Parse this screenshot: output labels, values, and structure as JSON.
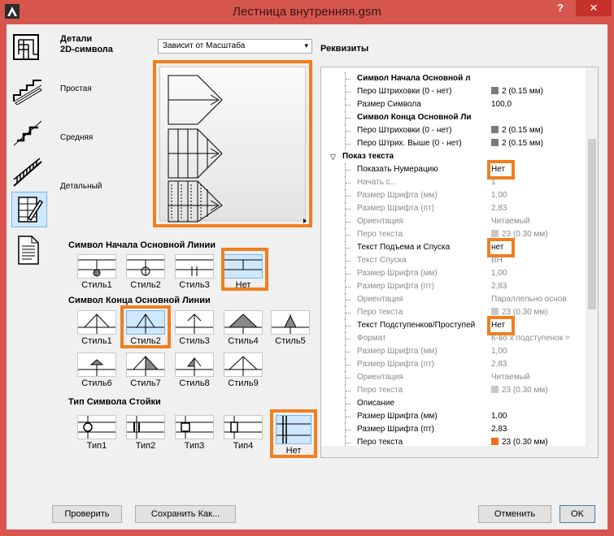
{
  "window": {
    "title": "Лестница внутренняя.gsm",
    "help_label": "?",
    "close_label": "✕"
  },
  "sidebar": {
    "items": [
      {
        "icon": "floor-plan-icon"
      },
      {
        "icon": "stair-section-icon"
      },
      {
        "icon": "stair-profile-icon"
      },
      {
        "icon": "stair-railing-icon"
      },
      {
        "icon": "stair-symbol-edit-icon",
        "selected": true
      },
      {
        "icon": "document-icon"
      }
    ]
  },
  "details": {
    "header": "Детали\n2D-символа",
    "simple": "Простая",
    "medium": "Средняя",
    "detailed": "Детальный",
    "dropdown_value": "Зависит от Масштаба",
    "dropdown_arrow": "▾"
  },
  "start_symbol": {
    "header": "Символ Начала Основной Линии",
    "options": [
      "Стиль1",
      "Стиль2",
      "Стиль3",
      "Нет"
    ],
    "selected": "Нет"
  },
  "end_symbol": {
    "header": "Символ Конца Основной Линии",
    "options": [
      "Стиль1",
      "Стиль2",
      "Стиль3",
      "Стиль4",
      "Стиль5",
      "Стиль6",
      "Стиль7",
      "Стиль8",
      "Стиль9"
    ],
    "selected": "Стиль2"
  },
  "post_symbol": {
    "header": "Тип Символа Стойки",
    "options": [
      "Тип1",
      "Тип2",
      "Тип3",
      "Тип4",
      "Нет"
    ],
    "selected": "Нет"
  },
  "props": {
    "header": "Реквизиты",
    "rows": [
      {
        "name": "Символ Начала Основной л",
        "value": "",
        "bold": true
      },
      {
        "name": "Перо Штриховки (0 - нет)",
        "value": "2 (0.15 мм)",
        "swatch": "#7a7a7a"
      },
      {
        "name": "Размер Символа",
        "value": "100,0"
      },
      {
        "name": "Символ Конца Основной Ли",
        "value": "",
        "bold": true
      },
      {
        "name": "Перо Штриховки (0 - нет)",
        "value": "2 (0.15 мм)",
        "swatch": "#7a7a7a"
      },
      {
        "name": "Перо Штрих. Выше (0 - нет)",
        "value": "2 (0.15 мм)",
        "swatch": "#7a7a7a"
      },
      {
        "name": "Показ текста",
        "value": "",
        "section": true
      },
      {
        "name": "Показать Нумерацию",
        "value": "Нет",
        "highlight": true
      },
      {
        "name": "Начать с...",
        "value": "1",
        "grey": true
      },
      {
        "name": "Размер Шрифта (мм)",
        "value": "1,00",
        "grey": true
      },
      {
        "name": "Размер Шрифта (пт)",
        "value": "2,83",
        "grey": true
      },
      {
        "name": "Ориентация",
        "value": "Читаемый",
        "grey": true
      },
      {
        "name": "Перо текста",
        "value": "23 (0.30 мм)",
        "grey": true,
        "swatch": "#c8c8c8"
      },
      {
        "name": "Текст Подъема и Спуска",
        "value": "нет",
        "highlight": true
      },
      {
        "name": "Текст Спуска",
        "value": "ВН",
        "grey": true
      },
      {
        "name": "Размер Шрифта (мм)",
        "value": "1,00",
        "grey": true
      },
      {
        "name": "Размер Шрифта (пт)",
        "value": "2,83",
        "grey": true
      },
      {
        "name": "Ориентация",
        "value": "Параллельно основ",
        "grey": true
      },
      {
        "name": "Перо текста",
        "value": "23 (0.30 мм)",
        "grey": true,
        "swatch": "#c8c8c8"
      },
      {
        "name": "Текст Подступенков/Проступей",
        "value": "Нет",
        "highlight": true
      },
      {
        "name": "Формат",
        "value": "К-во x подступенок =",
        "grey": true
      },
      {
        "name": "Размер Шрифта (мм)",
        "value": "1,00",
        "grey": true
      },
      {
        "name": "Размер Шрифта (пт)",
        "value": "2,83",
        "grey": true
      },
      {
        "name": "Ориентация",
        "value": "Читаемый",
        "grey": true
      },
      {
        "name": "Перо текста",
        "value": "23 (0.30 мм)",
        "grey": true,
        "swatch": "#c8c8c8"
      },
      {
        "name": "Описание",
        "value": ""
      },
      {
        "name": "Размер Шрифта (мм)",
        "value": "1,00"
      },
      {
        "name": "Размер Шрифта (пт)",
        "value": "2,83"
      },
      {
        "name": "Перо текста",
        "value": "23 (0.30 мм)",
        "swatch": "#f26b1d"
      }
    ]
  },
  "buttons": {
    "check": "Проверить",
    "save_as": "Сохранить Как...",
    "cancel": "Отменить",
    "ok": "OK"
  },
  "colors": {
    "accent_highlight": "#f07f1f",
    "selection": "#cde8ff",
    "window_frame": "#d9534f"
  }
}
